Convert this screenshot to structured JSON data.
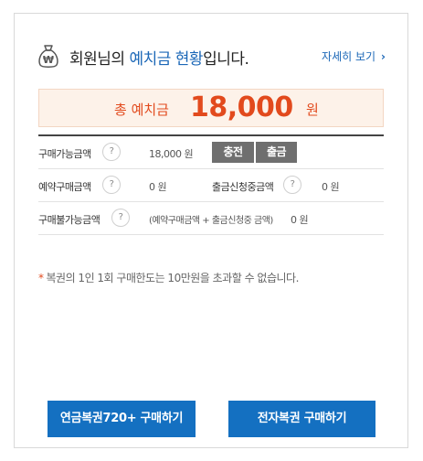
{
  "header": {
    "title_prefix": "회원님의 ",
    "title_highlight": "예치금 현황",
    "title_suffix": "입니다.",
    "more_label": "자세히 보기",
    "more_icon": "chevron-right-icon"
  },
  "total": {
    "label": "총 예치금",
    "amount": "18,000",
    "unit": "원"
  },
  "details": {
    "purchasable": {
      "label": "구매가능금액",
      "value": "18,000 원"
    },
    "charge_button": "충전",
    "withdraw_button": "출금",
    "reserved": {
      "label": "예약구매금액",
      "value": "0 원"
    },
    "withdraw_pending": {
      "label": "출금신청중금액",
      "value": "0 원"
    },
    "unavailable": {
      "label": "구매불가능금액",
      "formula": "(예약구매금액 + 출금신청중 금액)",
      "value": "0 원"
    },
    "help_symbol": "?"
  },
  "notice": {
    "star": "*",
    "text": "복권의 1인 1회 구매한도는 10만원을 초과할 수 없습니다."
  },
  "buttons": {
    "pension_lottery": "연금복권720+ 구매하기",
    "electronic_lottery": "전자복권 구매하기"
  },
  "colors": {
    "accent_blue": "#1470c1",
    "highlight_red": "#e24a1d",
    "gray_button": "#6f6f6f"
  }
}
